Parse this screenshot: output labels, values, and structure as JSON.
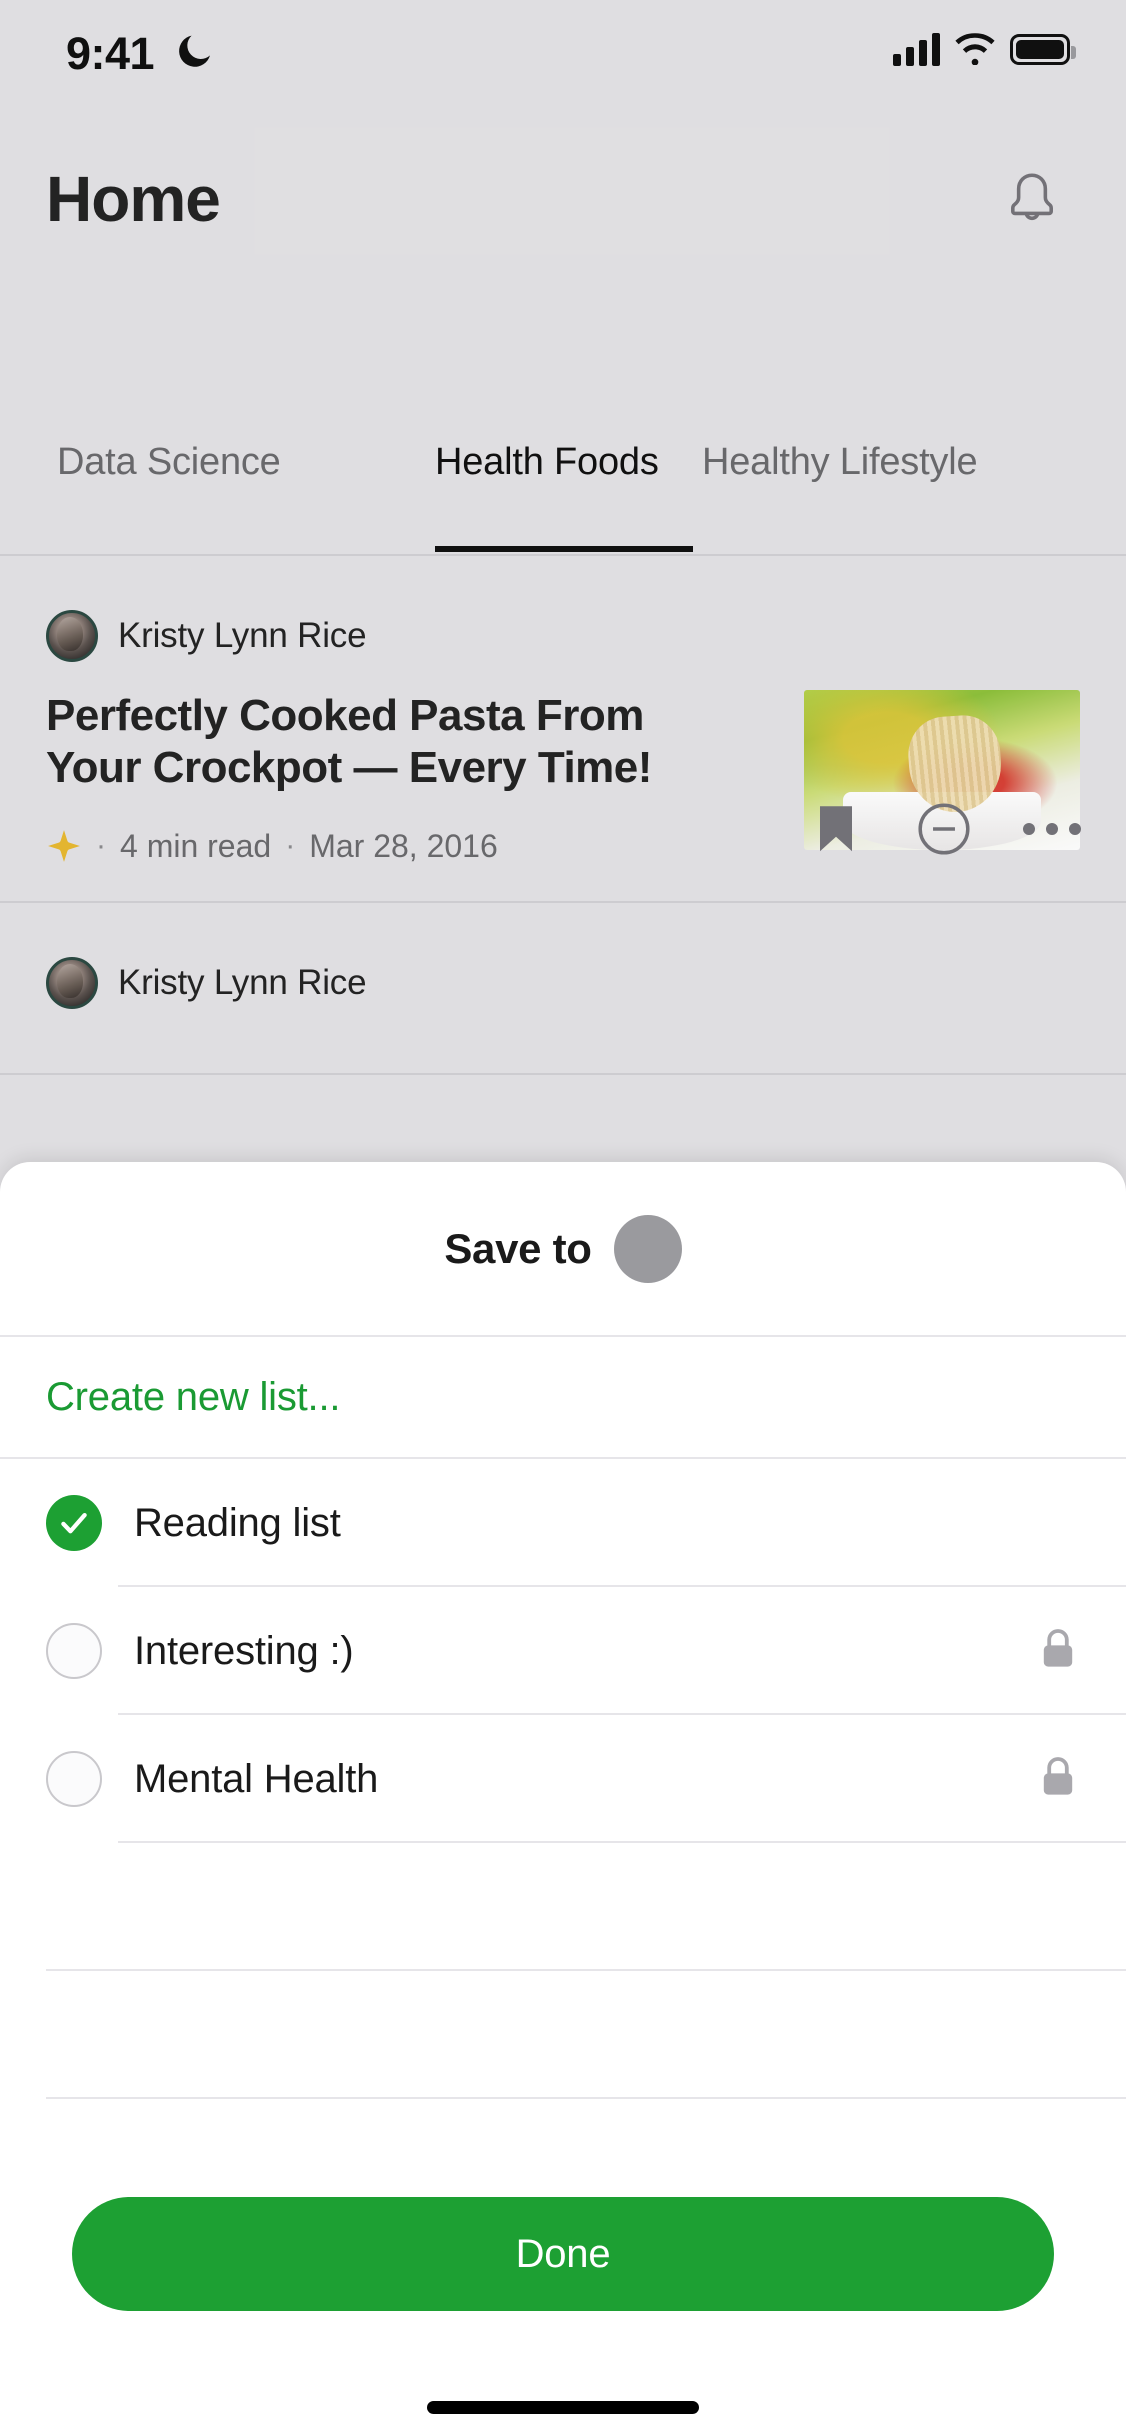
{
  "status_bar": {
    "time": "9:41",
    "moon_icon": "crescent-moon-icon",
    "signal_icon": "cellular-signal-icon",
    "wifi_icon": "wifi-icon",
    "battery_icon": "battery-full-icon"
  },
  "header": {
    "title": "Home",
    "bell_icon": "bell-icon"
  },
  "tabs": {
    "items": [
      {
        "label": "Data Science",
        "active": false
      },
      {
        "label": "Health Foods",
        "active": true
      },
      {
        "label": "Healthy Lifestyle",
        "active": false
      }
    ]
  },
  "feed": {
    "cards": [
      {
        "author": "Kristy Lynn Rice",
        "title": "Perfectly Cooked Pasta From Your Crockpot — Every Time!",
        "star_icon": "member-star-icon",
        "separator": "·",
        "read_time": "4  min read",
        "date": "Mar 28, 2016",
        "bookmark_icon": "bookmark-filled-icon",
        "mute_icon": "circle-minus-icon",
        "overflow_icon": "more-horizontal-icon",
        "thumbnail_alt": "pasta-thumbnail"
      },
      {
        "author": "Kristy Lynn Rice"
      }
    ]
  },
  "sheet": {
    "title": "Save to",
    "avatar_icon": "user-avatar-placeholder",
    "create_new": "Create new list...",
    "lists": [
      {
        "label": "Reading list",
        "checked": true,
        "private": false
      },
      {
        "label": "Interesting :)",
        "checked": false,
        "private": true,
        "lock_icon": "lock-icon"
      },
      {
        "label": "Mental Health",
        "checked": false,
        "private": true,
        "lock_icon": "lock-icon"
      }
    ],
    "done_label": "Done"
  },
  "colors": {
    "accent_green": "#1DA033",
    "link_green": "#1A9A33",
    "background": "#E4E3E6",
    "sheet_background": "#FFFFFF",
    "text_primary": "#242424",
    "text_secondary": "#6B6B6E",
    "star_yellow": "#E8B931"
  }
}
